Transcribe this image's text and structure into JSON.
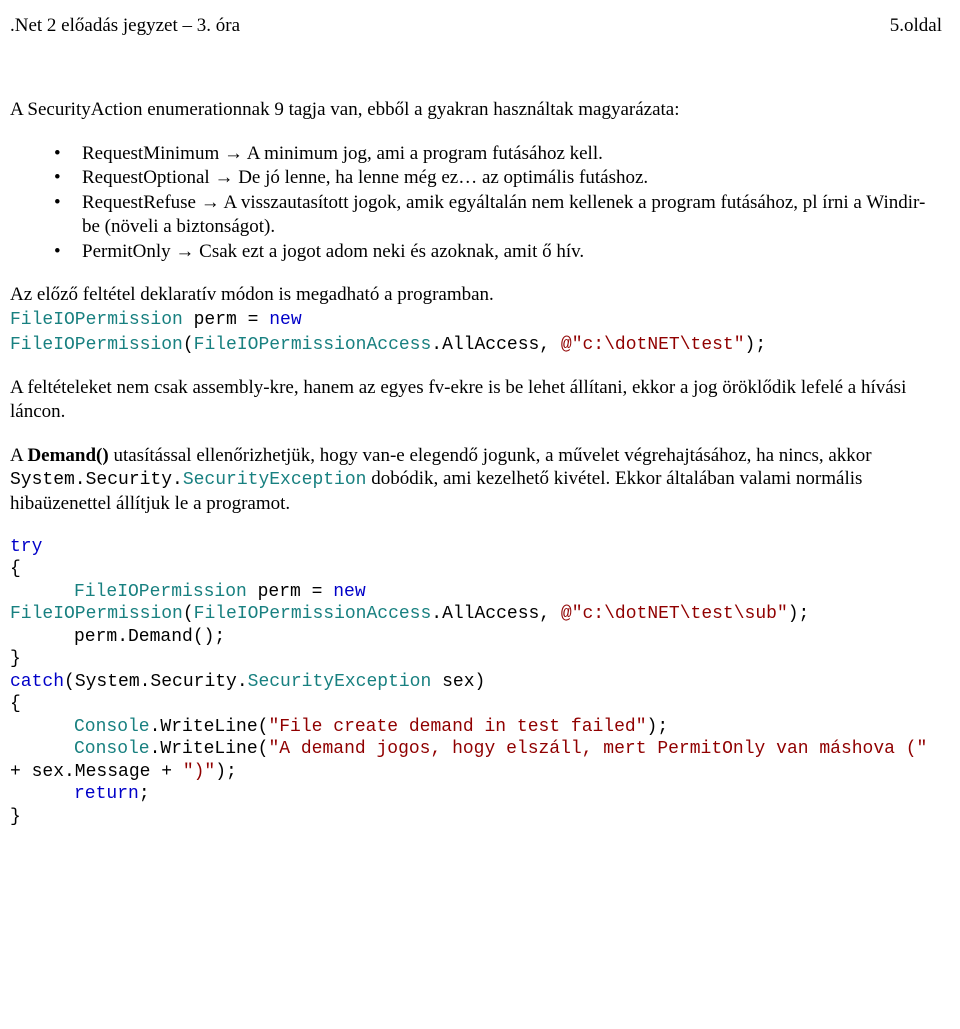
{
  "header": {
    "left": ".Net 2 előadás jegyzet – 3. óra",
    "right": "5.oldal"
  },
  "intro": "A SecurityAction enumerationnak 9 tagja van, ebből a gyakran használtak magyarázata:",
  "bullets": [
    {
      "term": "RequestMinimum",
      "desc": "A minimum jog, ami a program futásához kell."
    },
    {
      "term": "RequestOptional",
      "desc": "De jó lenne, ha lenne még ez… az optimális futáshoz."
    },
    {
      "term": "RequestRefuse",
      "desc": "A visszautasított jogok, amik egyáltalán nem kellenek a program futásához, pl írni a Windir-be (növeli a biztonságot)."
    },
    {
      "term": "PermitOnly",
      "desc": "Csak ezt a jogot adom neki és azoknak, amit ő hív."
    }
  ],
  "declarative_line": "Az előző feltétel deklaratív módon is megadható a programban.",
  "code1": {
    "cls1": "FileIOPermission",
    "word_perm": " perm = ",
    "kw_new": "new",
    "cls2": "FileIOPermission",
    "paren_open": "(",
    "cls3": "FileIOPermissionAccess",
    "dot_all": ".AllAccess, ",
    "str": "@\"c:\\dotNET\\test\"",
    "tail": ");"
  },
  "para_conditions": "A feltételeket nem csak assembly-kre, hanem az egyes fv-ekre is be lehet állítani, ekkor a jog öröklődik lefelé a hívási láncon.",
  "demand": {
    "pre1": "A ",
    "bold1": "Demand()",
    "mid1": " utasítással ellenőrizhetjük, hogy van-e elegendő jogunk, a művelet végrehajtásához, ha nincs, akkor ",
    "mono_sys": "System.Security.",
    "mono_exc": "SecurityException",
    "mid2": " dobódik, ami kezelhető kivétel. Ekkor általában valami normális hibaüzenettel állítjuk le a programot."
  },
  "code2": {
    "kw_try": "try",
    "brace_open": "{",
    "cls1": "FileIOPermission",
    "perm_eq": " perm = ",
    "kw_new": "new",
    "cls2": "FileIOPermission",
    "paren_open": "(",
    "cls3": "FileIOPermissionAccess",
    "dot_all": ".AllAccess, ",
    "str1": "@\"c:\\dotNET\\test\\sub\"",
    "tail1": ");",
    "demand_line": "perm.Demand();",
    "brace_close1": "}",
    "kw_catch": "catch",
    "catch_args_pre": "(System.Security.",
    "catch_args_cls": "SecurityException",
    "catch_args_post": " sex)",
    "brace_open2": "{",
    "cons": "Console",
    "write1_pre": ".WriteLine(",
    "write1_str": "\"File create demand in test failed\"",
    "write1_post": ");",
    "write2_pre": ".WriteLine(",
    "write2_str1": "\"A demand jogos, hogy elszáll, mert PermitOnly van máshova (\"",
    "write2_mid": " + sex.Message + ",
    "write2_str2": "\")\"",
    "write2_post": ");",
    "kw_return": "return",
    "semicolon": ";",
    "brace_close2": "}"
  }
}
